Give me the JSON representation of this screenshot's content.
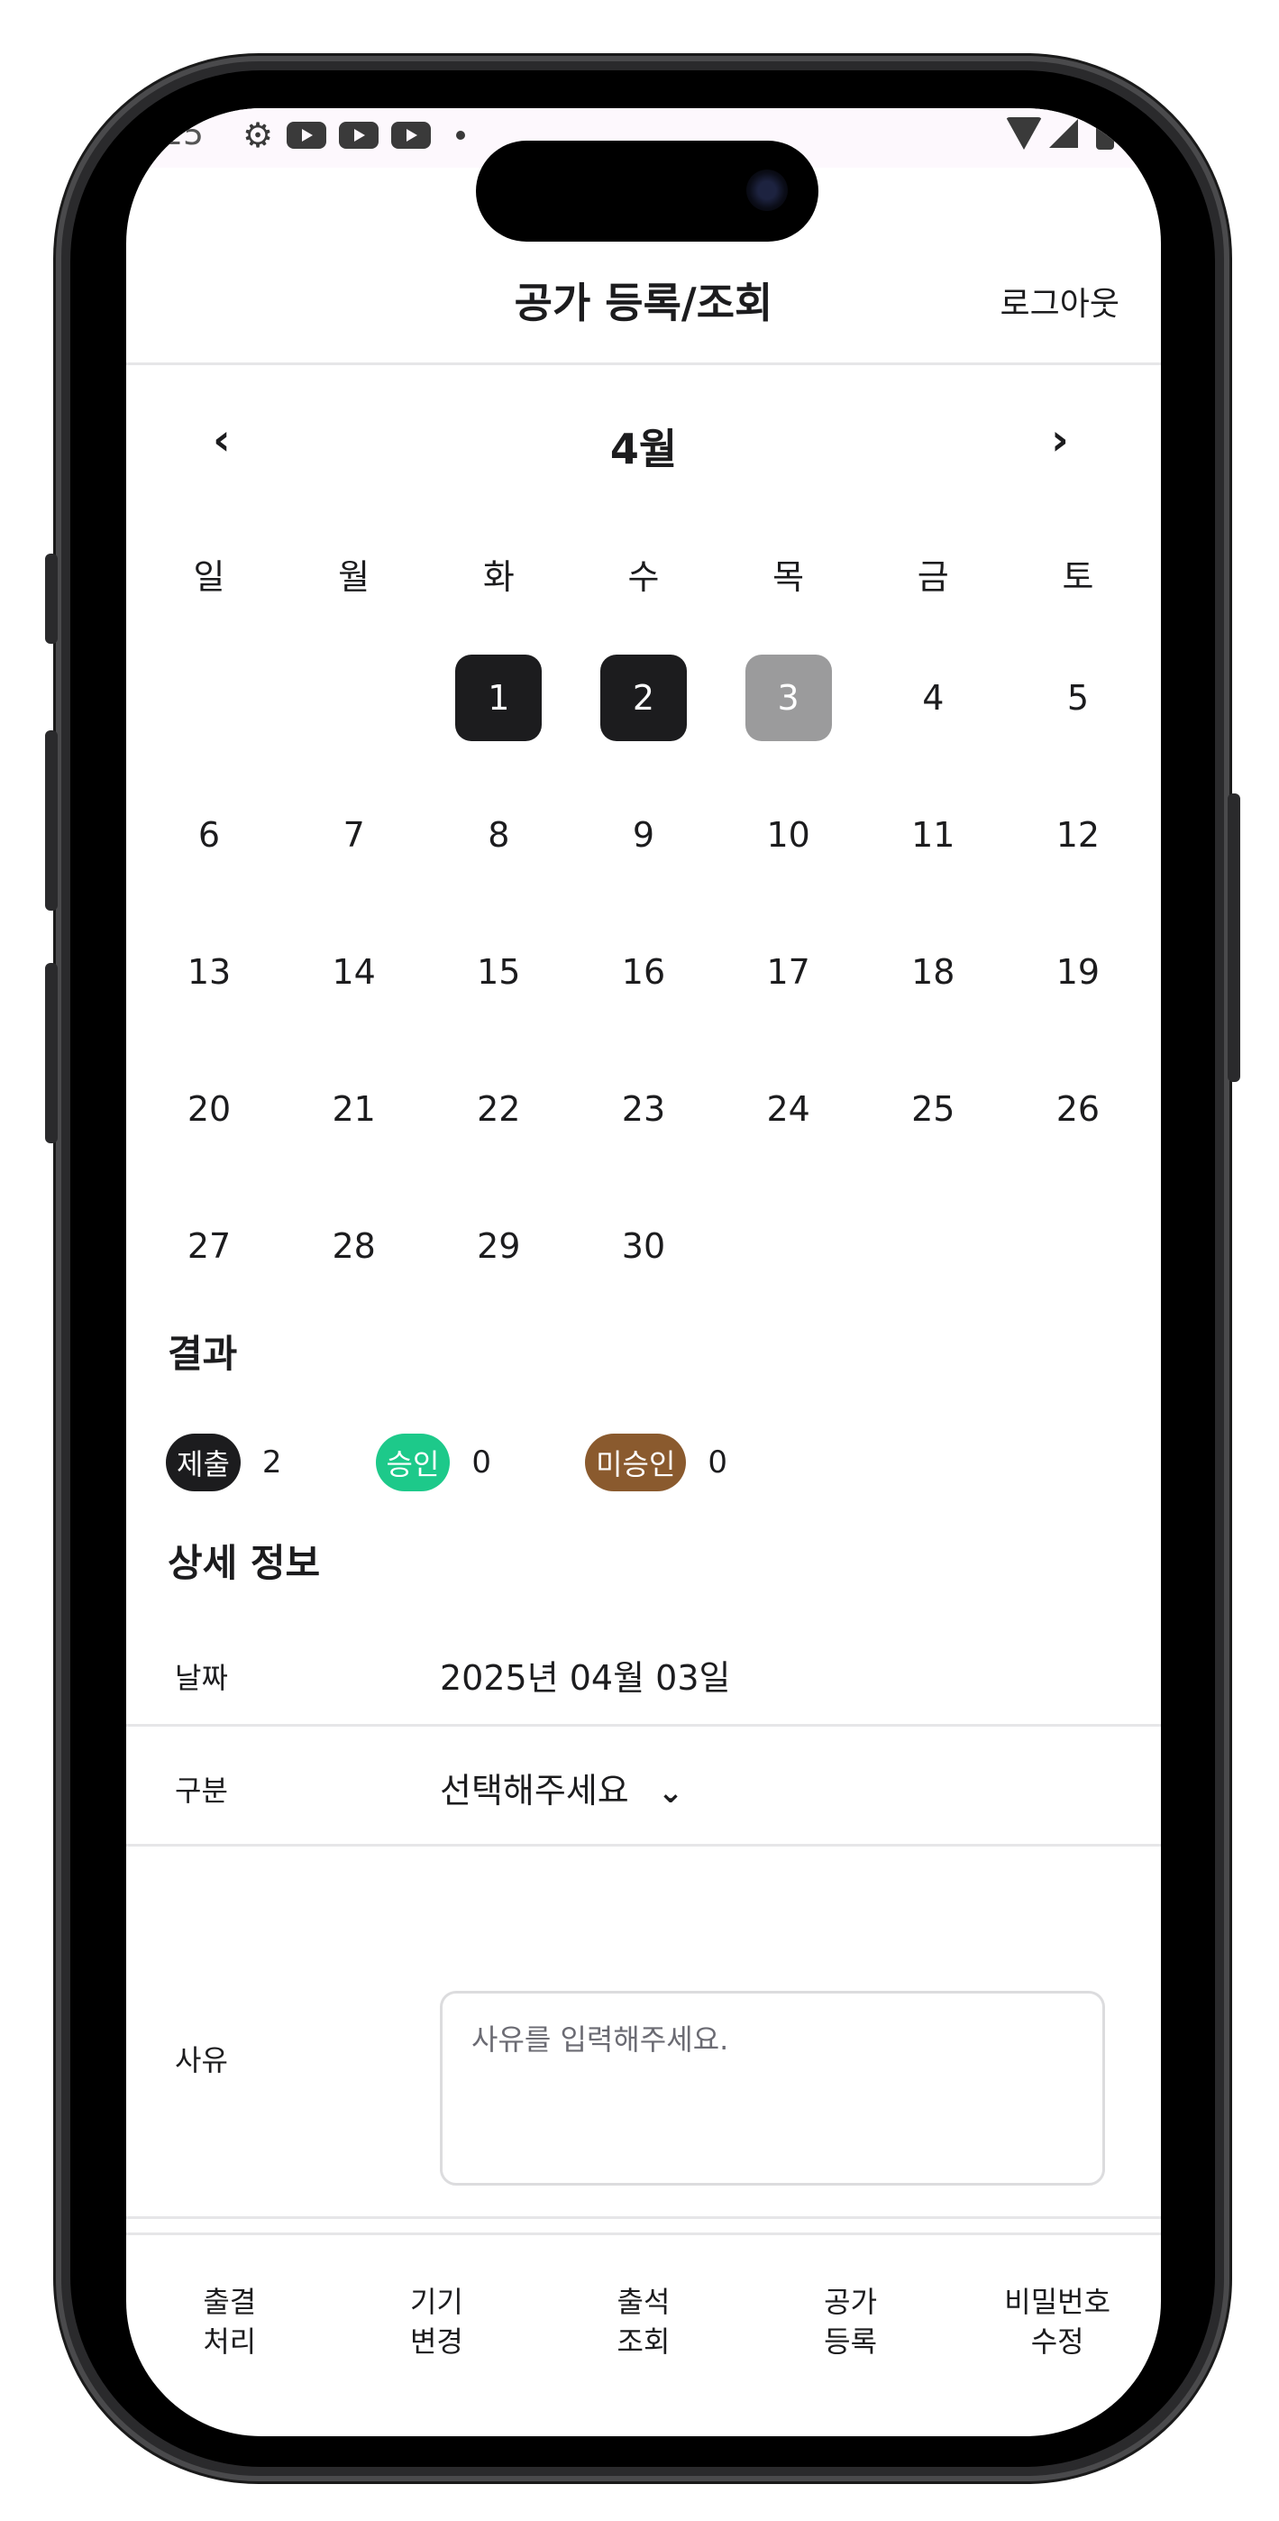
{
  "status_bar": {
    "time": ":25"
  },
  "header": {
    "title": "공가 등록/조회",
    "logout_label": "로그아웃"
  },
  "calendar": {
    "month": "4월",
    "prev": "‹",
    "next": "›",
    "weekdays": [
      "일",
      "월",
      "화",
      "수",
      "목",
      "금",
      "토"
    ],
    "weeks": [
      [
        "",
        "",
        "1",
        "2",
        "3",
        "4",
        "5"
      ],
      [
        "6",
        "7",
        "8",
        "9",
        "10",
        "11",
        "12"
      ],
      [
        "13",
        "14",
        "15",
        "16",
        "17",
        "18",
        "19"
      ],
      [
        "20",
        "21",
        "22",
        "23",
        "24",
        "25",
        "26"
      ],
      [
        "27",
        "28",
        "29",
        "30",
        "",
        "",
        ""
      ]
    ],
    "submitted_days": [
      "1",
      "2"
    ],
    "selected_day": "3"
  },
  "results": {
    "title": "결과",
    "items": [
      {
        "label": "제출",
        "count": "2",
        "color": "#1c1c1e"
      },
      {
        "label": "승인",
        "count": "0",
        "color": "#1dc98a"
      },
      {
        "label": "미승인",
        "count": "0",
        "color": "#8a5a2e"
      }
    ]
  },
  "detail": {
    "title": "상세 정보",
    "date_label": "날짜",
    "date_value": "2025년 04월 03일",
    "type_label": "구분",
    "type_value": "선택해주세요",
    "reason_label": "사유",
    "reason_placeholder": "사유를 입력해주세요."
  },
  "bottom_nav": [
    {
      "label": "출결\n처리"
    },
    {
      "label": "기기\n변경"
    },
    {
      "label": "출석\n조회"
    },
    {
      "label": "공가\n등록"
    },
    {
      "label": "비밀번호\n수정"
    }
  ]
}
